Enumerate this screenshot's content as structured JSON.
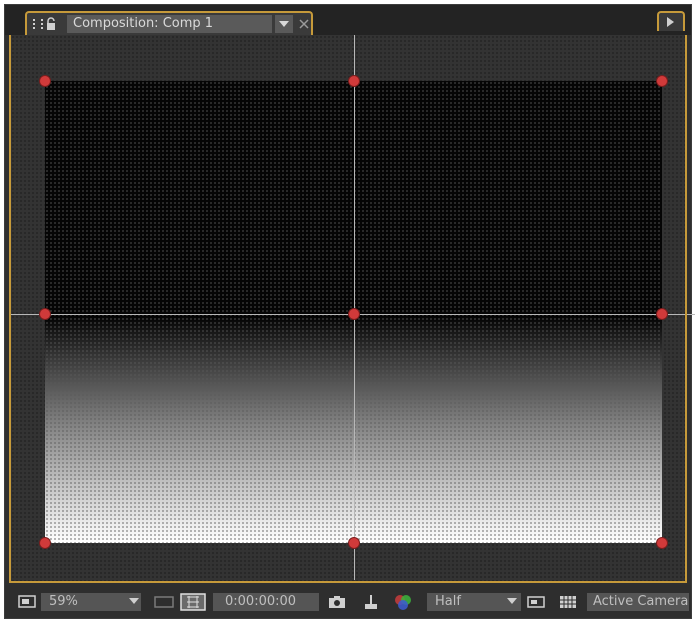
{
  "panel": {
    "tab_title": "Composition: Comp 1",
    "accent_color": "#c69a3a"
  },
  "viewer": {
    "handle_color": "#d03a3a",
    "comp_top_color": "#050505",
    "comp_bottom_gradient": [
      "#000000",
      "#ffffff"
    ]
  },
  "statusbar": {
    "zoom": "59%",
    "timecode": "0:00:00:00",
    "resolution": "Half",
    "camera": "Active Camera"
  },
  "icons": {
    "grip": "panel-grip-icon",
    "lock": "lock-icon",
    "tab_menu": "chevron-down-icon",
    "close": "close-icon",
    "flyout": "panel-menu-icon",
    "monitor": "monitor-icon",
    "safe_zones": "safe-zones-icon",
    "snapshot": "camera-icon",
    "show_snapshot": "show-snapshot-icon",
    "channel": "color-channel-icon",
    "region": "region-of-interest-icon",
    "transparency": "transparency-grid-icon"
  }
}
